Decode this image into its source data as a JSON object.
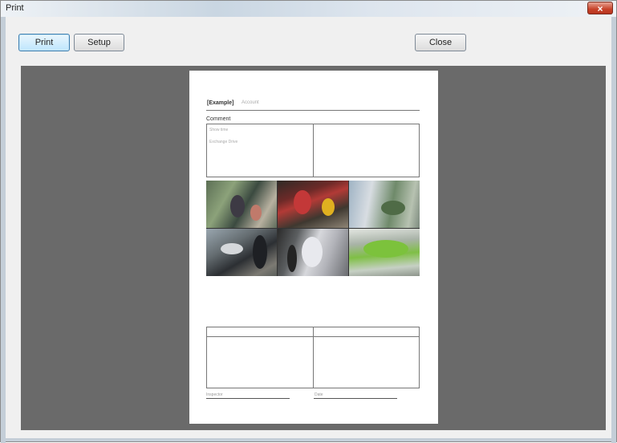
{
  "window": {
    "title": "Print",
    "close_glyph": "×"
  },
  "toolbar": {
    "print_label": "Print",
    "setup_label": "Setup",
    "close_label": "Close"
  },
  "preview_page": {
    "header_bold": "[Example]",
    "header_light": "Account",
    "comment_label": "Comment",
    "comment_line1": "Show time",
    "comment_line2": "Exchange Drive",
    "signature_label_1": "Inspector",
    "signature_label_2": "Date",
    "thumbnails": [
      "camera-1",
      "camera-2",
      "camera-3",
      "camera-4",
      "camera-5",
      "camera-6"
    ]
  },
  "colors": {
    "preview_background": "#6a6a6a",
    "page": "#ffffff",
    "titlebar_close": "#c7432a"
  }
}
